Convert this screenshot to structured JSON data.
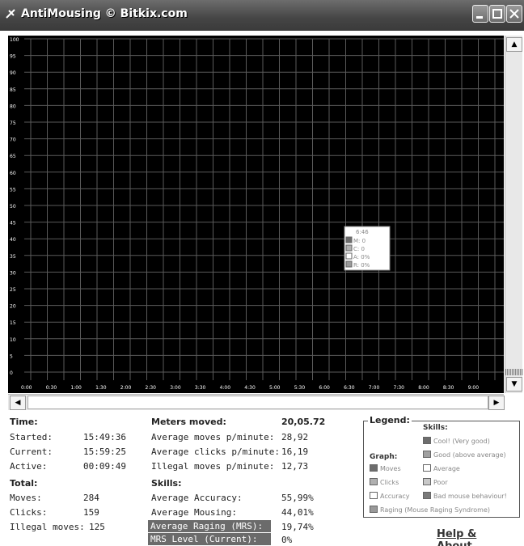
{
  "window": {
    "title": "AntiMousing © Bitkix.com"
  },
  "graph": {
    "y_ticks": [
      "100",
      "95",
      "90",
      "85",
      "80",
      "75",
      "70",
      "65",
      "60",
      "55",
      "50",
      "45",
      "40",
      "35",
      "30",
      "25",
      "20",
      "15",
      "10",
      "5",
      "0"
    ],
    "x_ticks": [
      "0:00",
      "0:30",
      "1:00",
      "1:30",
      "2:00",
      "2:30",
      "3:00",
      "3:30",
      "4:00",
      "4:30",
      "5:00",
      "5:30",
      "6:00",
      "6:30",
      "7:00",
      "7:30",
      "8:00",
      "8:30",
      "9:00"
    ],
    "tooltip": {
      "time": "6:46",
      "lines": [
        "M: 0",
        "C: 0",
        "A: 0%",
        "R: 0%"
      ]
    }
  },
  "time": {
    "header": "Time:",
    "started_label": "Started:",
    "started": "15:49:36",
    "current_label": "Current:",
    "current": "15:59:25",
    "active_label": "Active:",
    "active": "00:09:49"
  },
  "total": {
    "header": "Total:",
    "moves_label": "Moves:",
    "moves": "284",
    "clicks_label": "Clicks:",
    "clicks": "159",
    "illegal_label": "Illegal moves:",
    "illegal": "125"
  },
  "meters": {
    "header": "Meters moved:",
    "value": "20,05.72",
    "avg_moves_label": "Average moves p/minute:",
    "avg_moves": "28,92",
    "avg_clicks_label": "Average clicks p/minute:",
    "avg_clicks": "16,19",
    "illegal_pm_label": "Illegal moves p/minute:",
    "illegal_pm": "12,73"
  },
  "skills": {
    "header": "Skills:",
    "accuracy_label": "Average Accuracy:",
    "accuracy": "55,99%",
    "mousing_label": "Average Mousing:",
    "mousing": "44,01%",
    "raging_label": "Average Raging (MRS):",
    "raging": "19,74%",
    "mrs_label": "MRS Level (Current):",
    "mrs": "0%"
  },
  "legend": {
    "title": "Legend:",
    "skills_header": "Skills:",
    "graph_header": "Graph:",
    "cool": "Cool! (Very good)",
    "good": "Good (above average)",
    "average": "Average",
    "poor": "Poor",
    "bad": "Bad mouse behaviour!",
    "moves": "Moves",
    "clicks": "Clicks",
    "accuracy": "Accuracy",
    "raging": "Raging (Mouse Raging Syndrome)"
  },
  "help_link": "Help & About..."
}
